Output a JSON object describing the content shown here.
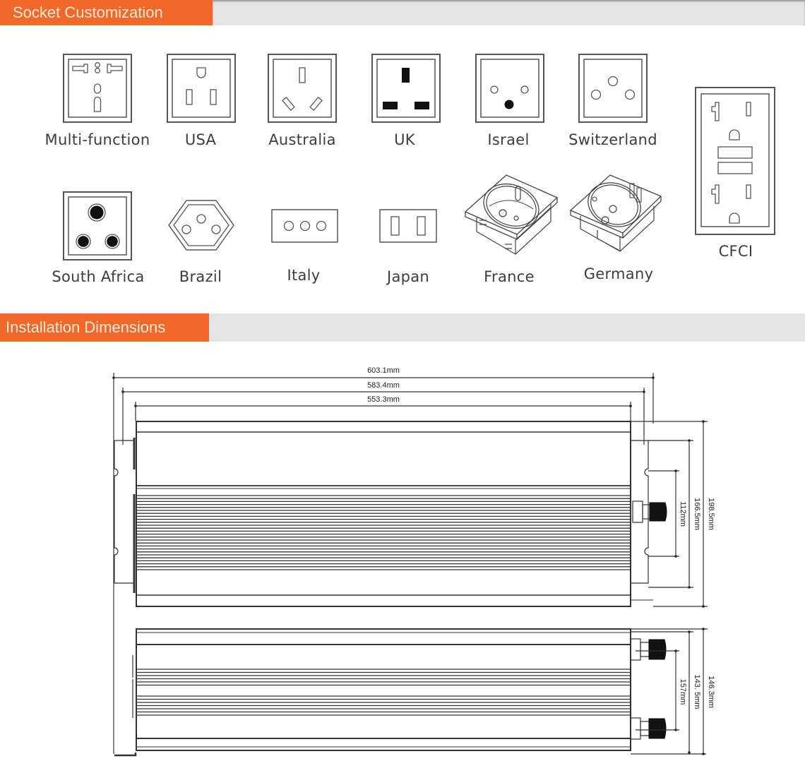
{
  "sections": {
    "socket_customization": {
      "title": "Socket Customization"
    },
    "installation_dimensions": {
      "title": "Installation Dimensions"
    }
  },
  "sockets": [
    {
      "label": "Multi-function",
      "icon": "multi-function-socket-icon"
    },
    {
      "label": "USA",
      "icon": "usa-socket-icon"
    },
    {
      "label": "Australia",
      "icon": "australia-socket-icon"
    },
    {
      "label": "UK",
      "icon": "uk-socket-icon"
    },
    {
      "label": "Israel",
      "icon": "israel-socket-icon"
    },
    {
      "label": "Switzerland",
      "icon": "switzerland-socket-icon"
    },
    {
      "label": "CFCI",
      "icon": "cfci-socket-icon"
    },
    {
      "label": "South Africa",
      "icon": "south-africa-socket-icon"
    },
    {
      "label": "Brazil",
      "icon": "brazil-socket-icon"
    },
    {
      "label": "Italy",
      "icon": "italy-socket-icon"
    },
    {
      "label": "Japan",
      "icon": "japan-socket-icon"
    },
    {
      "label": "France",
      "icon": "france-socket-icon"
    },
    {
      "label": "Germany",
      "icon": "germany-socket-icon"
    }
  ],
  "dimensions": {
    "top_view": {
      "overall_length": "603.1mm",
      "mounting_length": "583.4mm",
      "body_length": "553.3mm",
      "overall_width": "198.5mm",
      "flange_width": "166.5mm",
      "slot_spacing": "112mm"
    },
    "side_view": {
      "overall_height": "146.3mm",
      "body_height": "143. 5mm",
      "terminal_spacing": "157mm"
    }
  },
  "colors": {
    "accent": "#f0692a",
    "accent_text": "#fde9d6",
    "section_bar": "#e4e4e5",
    "line": "#555555"
  }
}
